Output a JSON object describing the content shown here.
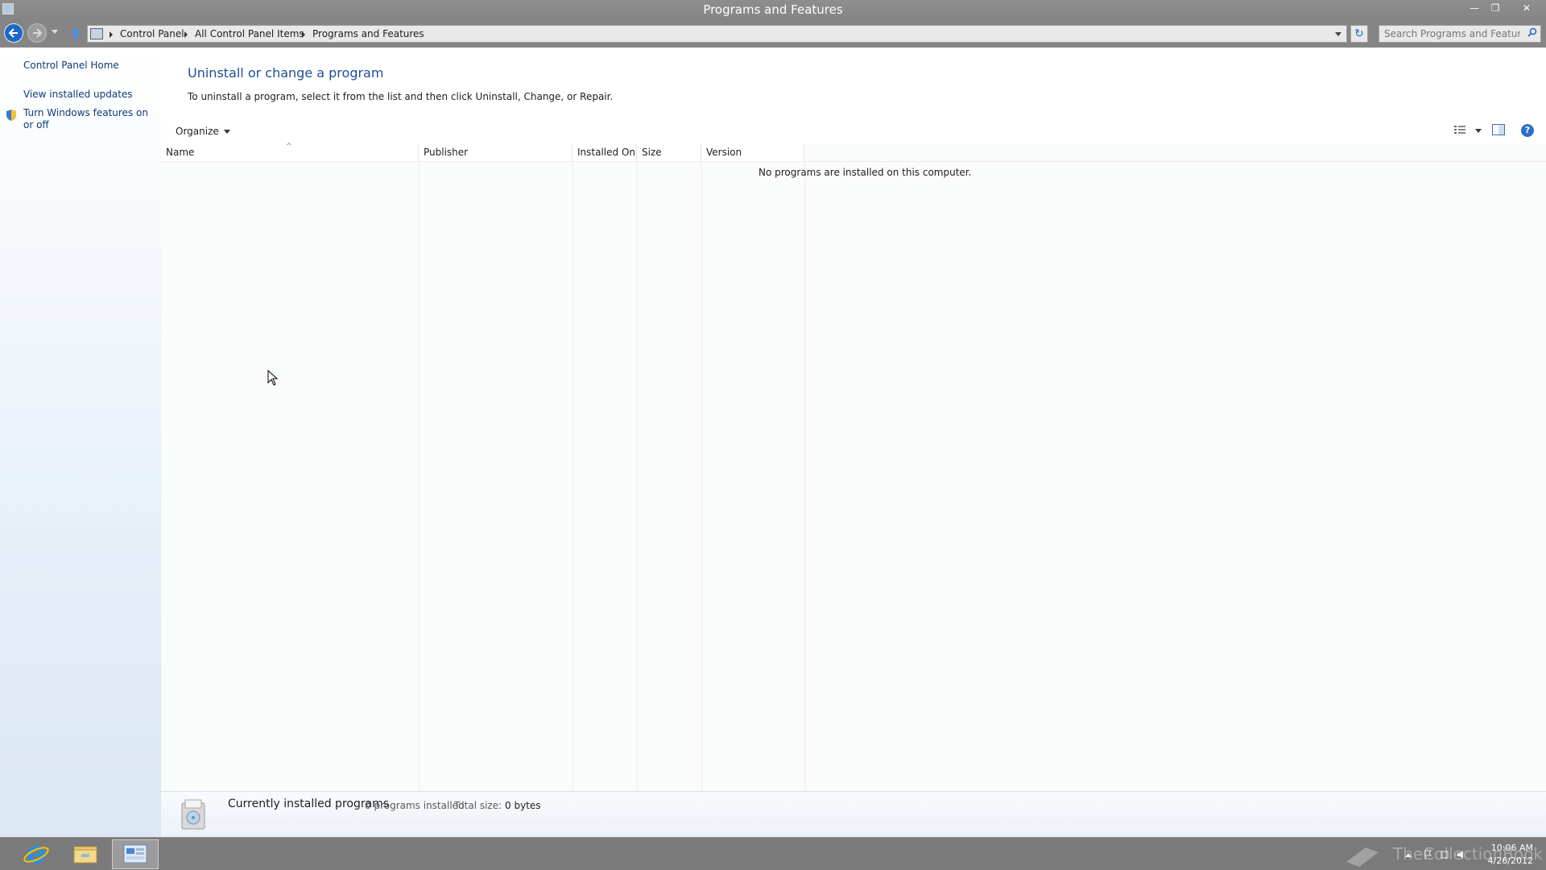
{
  "window": {
    "title": "Programs and Features",
    "minimize": "—",
    "maximize": "❐",
    "close": "✕"
  },
  "address_bar": {
    "breadcrumbs": [
      "Control Panel",
      "All Control Panel Items",
      "Programs and Features"
    ],
    "refresh_glyph": "↻",
    "search_placeholder": "Search Programs and Features"
  },
  "sidebar": {
    "items": [
      {
        "label": "Control Panel Home"
      },
      {
        "label": "View installed updates"
      },
      {
        "label": "Turn Windows features on or off"
      }
    ]
  },
  "main": {
    "heading": "Uninstall or change a program",
    "instruction": "To uninstall a program, select it from the list and then click Uninstall, Change, or Repair.",
    "toolbar": {
      "organize_label": "Organize",
      "help_glyph": "?"
    },
    "columns": [
      "Name",
      "Publisher",
      "Installed On",
      "Size",
      "Version"
    ],
    "sort_indicator": "^",
    "empty_message": "No programs are installed on this computer."
  },
  "details_pane": {
    "title": "Currently installed programs",
    "count": "0 programs installed",
    "total_size_label": "Total size:",
    "total_size": "0 bytes"
  },
  "taskbar": {
    "apps": [
      "internet-explorer-icon",
      "file-explorer-icon",
      "control-panel-icon"
    ],
    "watermark": "TheCollectionBook",
    "time": "10:06 AM",
    "date": "4/26/2012"
  },
  "colors": {
    "accent": "#1e67c5",
    "heading": "#1f4f94",
    "link": "#0e3a7a",
    "titlebar": "#8a8a8a",
    "taskbar": "#7a7a7a"
  }
}
